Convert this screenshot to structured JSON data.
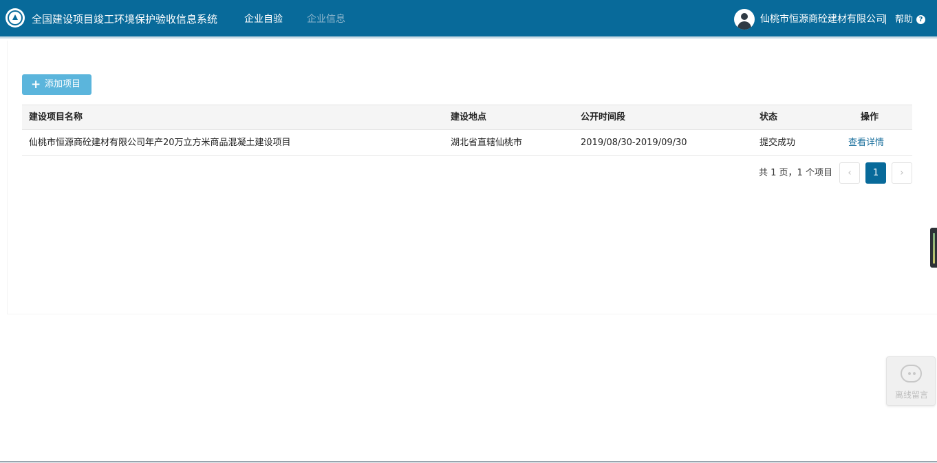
{
  "header": {
    "app_title": "全国建设项目竣工环境保护验收信息系统",
    "nav": [
      {
        "label": "企业自验"
      },
      {
        "label": "企业信息"
      }
    ],
    "company_name": "仙桃市恒源商砼建材有限公司",
    "separator": "|",
    "help_label": "帮助",
    "help_icon_glyph": "?",
    "colors": {
      "bar": "#086a9a",
      "inactive_nav": "#8fb7cd"
    }
  },
  "toolbar": {
    "add_label": "添加项目",
    "add_glyph": "+",
    "add_color": "#5bb5dc"
  },
  "table": {
    "columns": [
      "建设项目名称",
      "建设地点",
      "公开时间段",
      "状态",
      "操作"
    ],
    "rows": [
      {
        "name": "仙桃市恒源商砼建材有限公司年产20万立方米商品混凝土建设项目",
        "location": "湖北省直辖仙桃市",
        "period": "2019/08/30-2019/09/30",
        "status": "提交成功",
        "action": "查看详情"
      }
    ]
  },
  "pagination": {
    "summary": "共 1 页，1 个项目",
    "prev_glyph": "‹",
    "current_page": "1",
    "next_glyph": "›"
  },
  "widget": {
    "label": "离线留言"
  }
}
